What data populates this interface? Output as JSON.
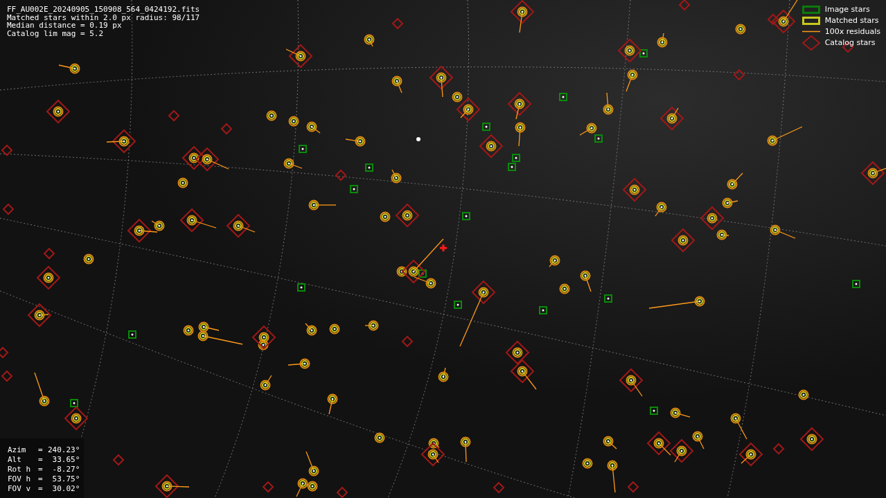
{
  "header_lines": [
    "FF_AU002E_20240905_150908_564_0424192.fits",
    "Matched stars within 2.0 px radius: 98/117",
    "Median distance = 0.19 px",
    "Catalog lim mag = 5.2"
  ],
  "legend": [
    {
      "kind": "image",
      "label": "Image stars"
    },
    {
      "kind": "matched",
      "label": "Matched stars"
    },
    {
      "kind": "residual",
      "label": "100x residuals"
    },
    {
      "kind": "catalog",
      "label": "Catalog stars"
    }
  ],
  "pointing": [
    {
      "label": "Azim",
      "sign": "=",
      "value": "240.23°"
    },
    {
      "label": "Alt",
      "sign": "=",
      "value": "33.65°"
    },
    {
      "label": "Rot h",
      "sign": "=",
      "value": "-8.27°"
    },
    {
      "label": "FOV h",
      "sign": "=",
      "value": "53.75°"
    },
    {
      "label": "FOV v",
      "sign": "=",
      "value": "30.02°"
    }
  ]
}
